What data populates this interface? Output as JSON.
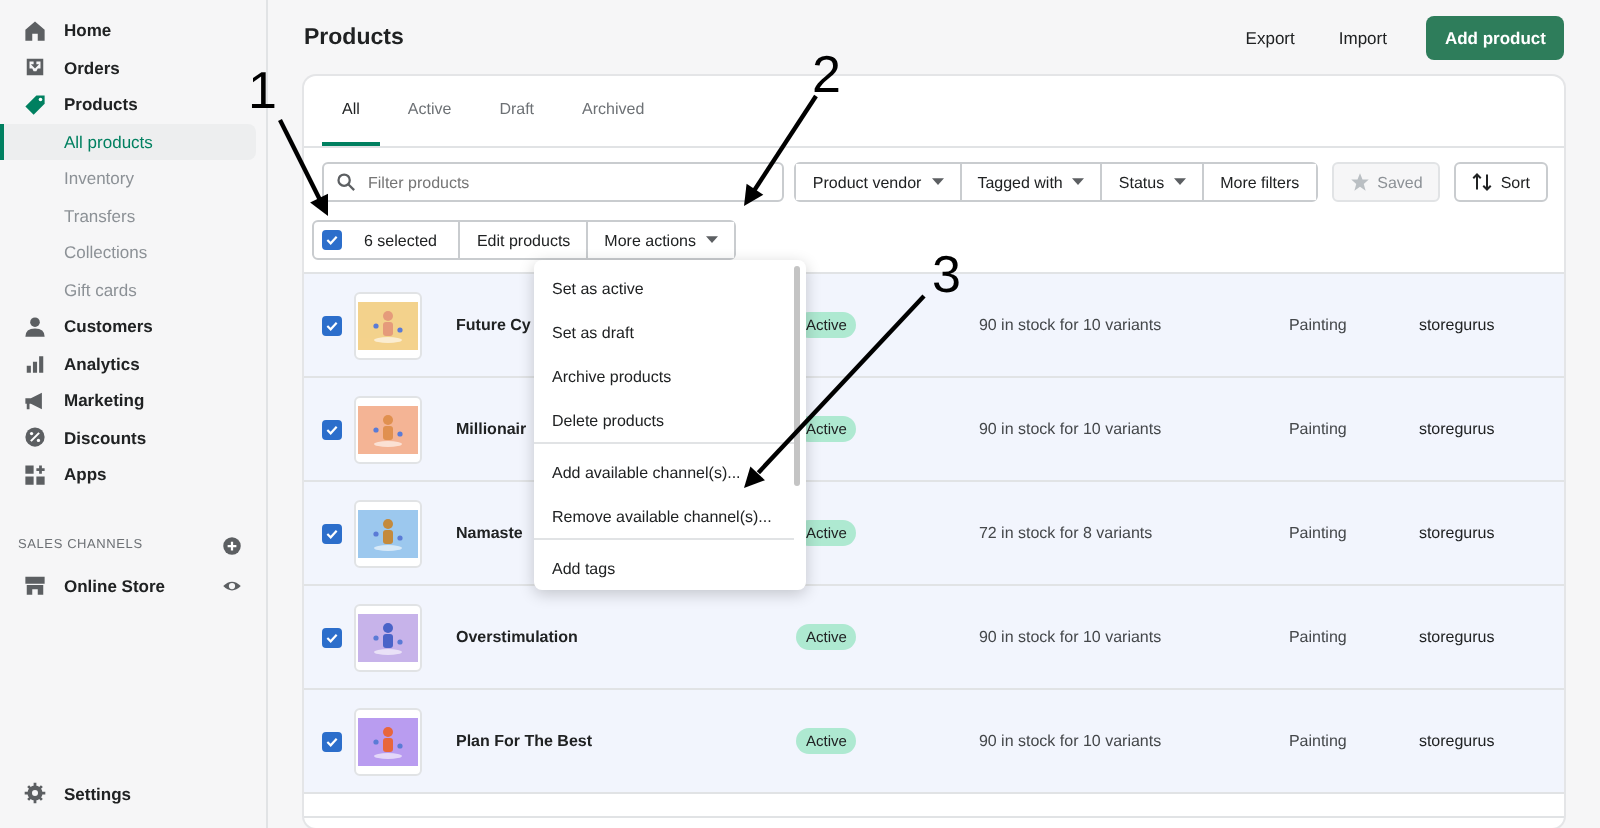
{
  "sidebar": {
    "items": [
      {
        "label": "Home",
        "selected": false
      },
      {
        "label": "Orders",
        "selected": false
      },
      {
        "label": "Products",
        "selected": false,
        "children": [
          {
            "label": "All products",
            "selected": true
          },
          {
            "label": "Inventory",
            "selected": false
          },
          {
            "label": "Transfers",
            "selected": false
          },
          {
            "label": "Collections",
            "selected": false
          },
          {
            "label": "Gift cards",
            "selected": false
          }
        ]
      },
      {
        "label": "Customers",
        "selected": false
      },
      {
        "label": "Analytics",
        "selected": false
      },
      {
        "label": "Marketing",
        "selected": false
      },
      {
        "label": "Discounts",
        "selected": false
      },
      {
        "label": "Apps",
        "selected": false
      }
    ],
    "sales_channels": {
      "heading": "SALES CHANNELS",
      "items": [
        {
          "label": "Online Store"
        }
      ]
    },
    "settings": "Settings"
  },
  "page": {
    "title": "Products",
    "actions": [
      "Export",
      "Import"
    ],
    "primary_action": "Add product"
  },
  "tabs": [
    {
      "label": "All",
      "selected": true
    },
    {
      "label": "Active",
      "selected": false
    },
    {
      "label": "Draft",
      "selected": false
    },
    {
      "label": "Archived",
      "selected": false
    }
  ],
  "filters": {
    "search": {
      "placeholder": "Filter products"
    },
    "dropdowns": [
      "Product vendor",
      "Tagged with",
      "Status"
    ],
    "more": "More filters",
    "saved": {
      "label": "Saved",
      "disabled": true
    },
    "sort": "Sort"
  },
  "bulk": {
    "checked": true,
    "count": "6 selected",
    "edit": "Edit products",
    "more": "More actions"
  },
  "menu": {
    "sections": [
      [
        "Set as active",
        "Set as draft",
        "Archive products",
        "Delete products"
      ],
      [
        "Add available channel(s)...",
        "Remove available channel(s)..."
      ],
      [
        "Add tags"
      ]
    ]
  },
  "rows": [
    {
      "checked": true,
      "name": "Future Cy",
      "status": "Active",
      "inventory": "90 in stock for 10 variants",
      "type": "Painting",
      "vendor": "storegurus"
    },
    {
      "checked": true,
      "name": "Millionair",
      "status": "Active",
      "inventory": "90 in stock for 10 variants",
      "type": "Painting",
      "vendor": "storegurus"
    },
    {
      "checked": true,
      "name": "Namaste",
      "status": "Active",
      "inventory": "72 in stock for 8 variants",
      "type": "Painting",
      "vendor": "storegurus"
    },
    {
      "checked": true,
      "name": "Overstimulation",
      "status": "Active",
      "inventory": "90 in stock for 10 variants",
      "type": "Painting",
      "vendor": "storegurus"
    },
    {
      "checked": true,
      "name": "Plan For The Best",
      "status": "Active",
      "inventory": "90 in stock for 10 variants",
      "type": "Painting",
      "vendor": "storegurus"
    }
  ],
  "annotations": [
    {
      "label": "1"
    },
    {
      "label": "2"
    },
    {
      "label": "3"
    }
  ]
}
